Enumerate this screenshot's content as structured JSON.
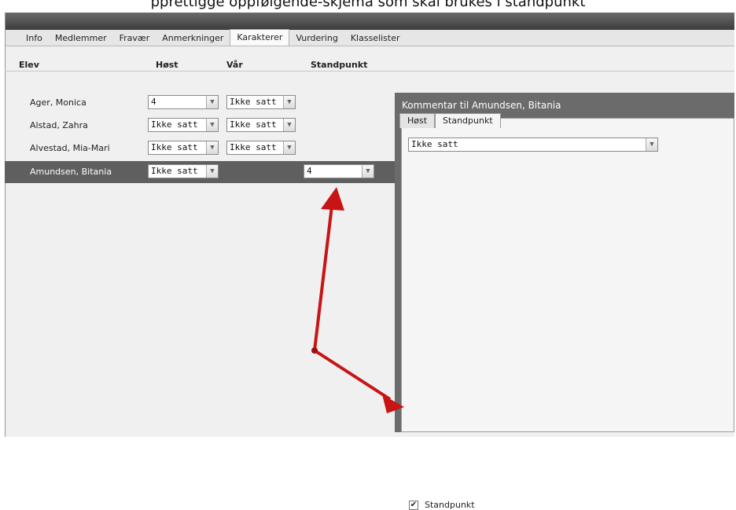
{
  "header": {
    "caption": "pprettigge oppfølgende-skjema som skal brukes i standpunkt"
  },
  "tabs": [
    "Info",
    "Medlemmer",
    "Fravær",
    "Anmerkninger",
    "Karakterer",
    "Vurdering",
    "Klasselister"
  ],
  "active_tab": "Karakterer",
  "columns": {
    "elev": "Elev",
    "host": "Høst",
    "var": "Vår",
    "standpunkt": "Standpunkt"
  },
  "students": [
    {
      "name": "Ager, Monica",
      "host": "4",
      "var": "Ikke satt"
    },
    {
      "name": "Alstad, Zahra",
      "host": "Ikke satt",
      "var": "Ikke satt"
    },
    {
      "name": "Alvestad, Mia-Mari",
      "host": "Ikke satt",
      "var": "Ikke satt"
    },
    {
      "name": "Amundsen, Bitania",
      "host": "Ikke satt",
      "standpunkt": "4"
    }
  ],
  "comment_panel": {
    "title": "Kommentar til Amundsen, Bitania",
    "tabs": [
      "Høst",
      "Standpunkt"
    ],
    "active_tab": "Standpunkt",
    "select_value": "Ikke satt",
    "checkbox_label": "Standpunkt",
    "checkbox_checked": true
  },
  "colors": {
    "annotation_arrow": "#c81414",
    "selected_row": "#5f5f5f"
  }
}
